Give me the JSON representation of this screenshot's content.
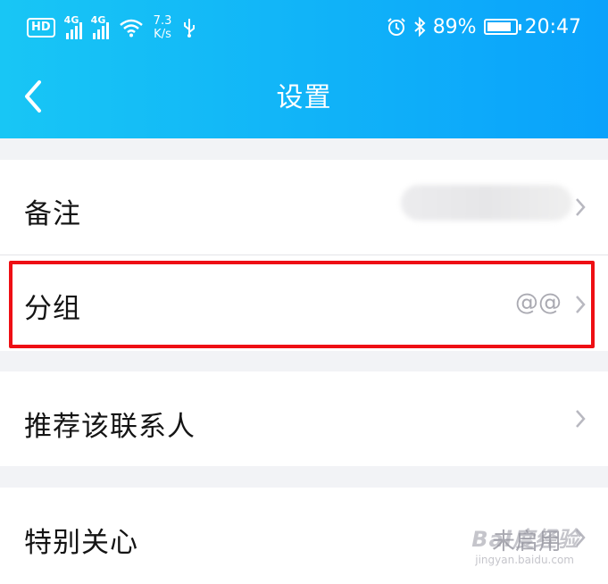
{
  "status_bar": {
    "hd": "HD",
    "network1": "4G",
    "network2": "4G",
    "speed_value": "7.3",
    "speed_unit": "K/s",
    "battery_percent": "89%",
    "battery_level": 0.89,
    "time": "20:47",
    "icons": [
      "hd-icon",
      "signal-icon",
      "signal-icon",
      "wifi-icon",
      "usb-icon",
      "alarm-icon",
      "bluetooth-icon",
      "battery-icon"
    ]
  },
  "header": {
    "title": "设置",
    "back_icon": "chevron-left-icon",
    "gradient": [
      "#18c6f5",
      "#0aa2fb"
    ]
  },
  "rows": [
    {
      "label": "备注",
      "value": ""
    },
    {
      "label": "分组",
      "value": "@@"
    },
    {
      "label": "推荐该联系人",
      "value": ""
    },
    {
      "label": "特别关心",
      "value": "未启用"
    }
  ],
  "highlight_color": "#ee0f14",
  "watermark": {
    "text": "Bai度经验",
    "sub": "jingyan.baidu.com"
  }
}
